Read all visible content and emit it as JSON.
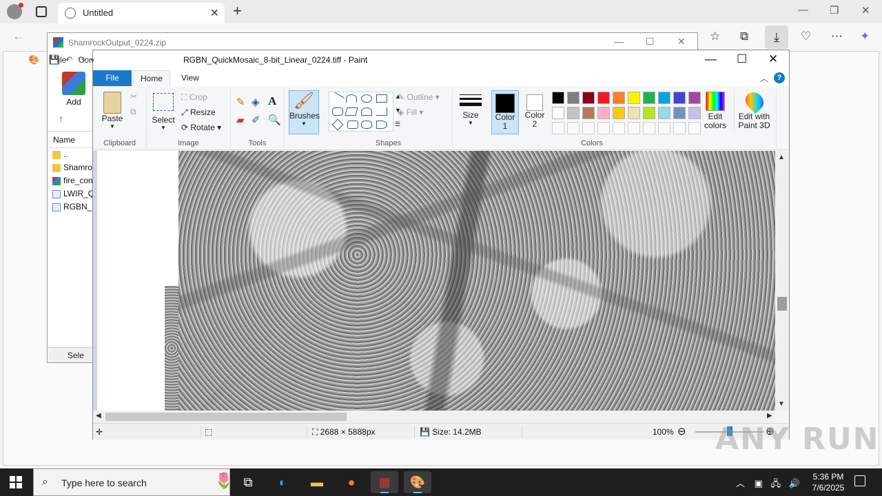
{
  "browser": {
    "tab_title": "Untitled"
  },
  "winrar": {
    "title": "ShamrockOutput_0224.zip",
    "menu": [
      "File",
      "Com"
    ],
    "add_label": "Add",
    "column_name": "Name",
    "items": [
      "..",
      "Shamro",
      "fire_con",
      "LWIR_Q",
      "RGBN_C"
    ],
    "status": "Sele"
  },
  "paint": {
    "title": "RGBN_QuickMosaic_8-bit_Linear_0224.tiff - Paint",
    "tabs": {
      "file": "File",
      "home": "Home",
      "view": "View"
    },
    "clipboard": {
      "paste": "Paste",
      "group": "Clipboard"
    },
    "image": {
      "select": "Select",
      "crop": "Crop",
      "resize": "Resize",
      "rotate": "Rotate",
      "group": "Image"
    },
    "tools": {
      "group": "Tools"
    },
    "brushes": "Brushes",
    "shapes": {
      "outline": "Outline",
      "fill": "Fill",
      "group": "Shapes"
    },
    "size": "Size",
    "color1": "Color 1",
    "color2": "Color 2",
    "colors_group": "Colors",
    "edit_colors": "Edit colors",
    "edit_3d": "Edit with Paint 3D",
    "palette_row1": [
      "#000000",
      "#7f7f7f",
      "#880015",
      "#ed1c24",
      "#ff7f27",
      "#fff200",
      "#22b14c",
      "#00a2e8",
      "#3f48cc",
      "#a349a4"
    ],
    "palette_row2": [
      "#ffffff",
      "#c3c3c3",
      "#b97a57",
      "#ffaec9",
      "#ffc90e",
      "#efe4b0",
      "#b5e61d",
      "#99d9ea",
      "#7092be",
      "#c8bfe7"
    ],
    "status": {
      "dimensions": "2688 × 5888px",
      "size": "Size: 14.2MB",
      "zoom": "100%"
    },
    "zoom_level": 0.5
  },
  "taskbar": {
    "search_placeholder": "Type here to search",
    "time": "5:36 PM",
    "date": "7/6/2025"
  },
  "watermark": "ANY RUN"
}
